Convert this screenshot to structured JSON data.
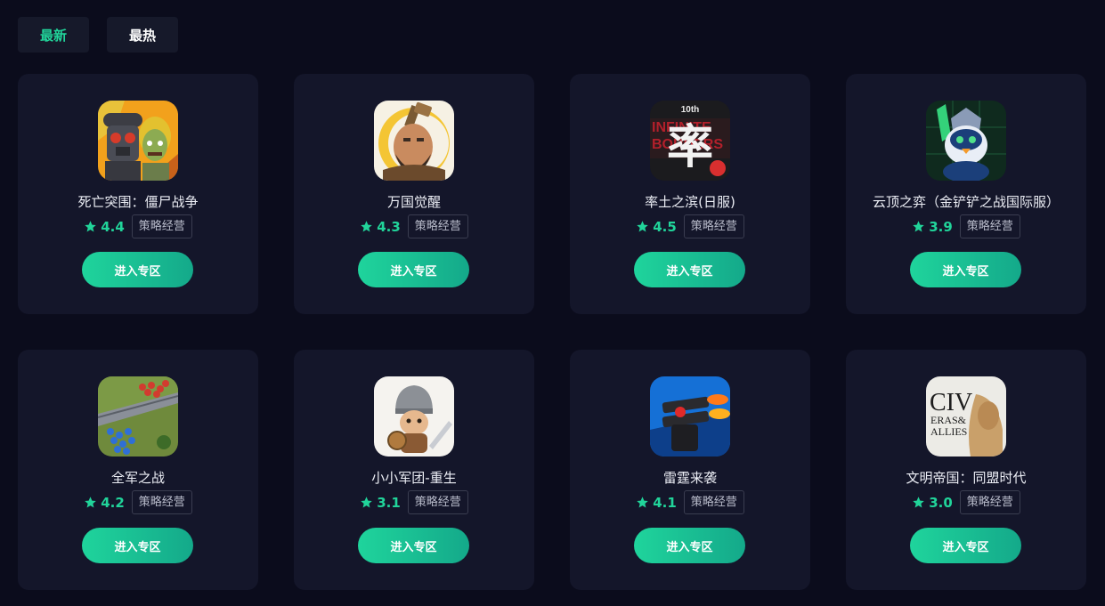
{
  "tabs": [
    {
      "label": "最新",
      "active": true
    },
    {
      "label": "最热",
      "active": false
    }
  ],
  "accent_color": "#21d49a",
  "games": [
    {
      "name": "死亡突围：僵尸战争",
      "rating": "4.4",
      "tag": "策略经营",
      "button": "进入专区",
      "icon": "zombie-soldier-icon"
    },
    {
      "name": "万国觉醒",
      "rating": "4.3",
      "tag": "策略经营",
      "button": "进入专区",
      "icon": "warrior-chief-icon"
    },
    {
      "name": "率土之滨(日服)",
      "rating": "4.5",
      "tag": "策略经营",
      "button": "进入专区",
      "icon": "infinite-borders-icon",
      "icon_text": {
        "badge": "10th",
        "glyph": "率"
      }
    },
    {
      "name": "云顶之弈（金铲铲之战国际服）",
      "rating": "3.9",
      "tag": "策略经营",
      "button": "进入专区",
      "icon": "penguin-knight-icon"
    },
    {
      "name": "全军之战",
      "rating": "4.2",
      "tag": "策略经营",
      "button": "进入专区",
      "icon": "army-battle-icon"
    },
    {
      "name": "小小军团-重生",
      "rating": "3.1",
      "tag": "策略经营",
      "button": "进入专区",
      "icon": "little-knight-icon"
    },
    {
      "name": "雷霆来袭",
      "rating": "4.1",
      "tag": "策略经营",
      "button": "进入专区",
      "icon": "turret-cannon-icon"
    },
    {
      "name": "文明帝国：同盟时代",
      "rating": "3.0",
      "tag": "策略经营",
      "button": "进入专区",
      "icon": "civ-eras-allies-icon",
      "icon_text": {
        "line1": "CIV",
        "line2": "ERAS&",
        "line3": "ALLIES"
      }
    }
  ]
}
